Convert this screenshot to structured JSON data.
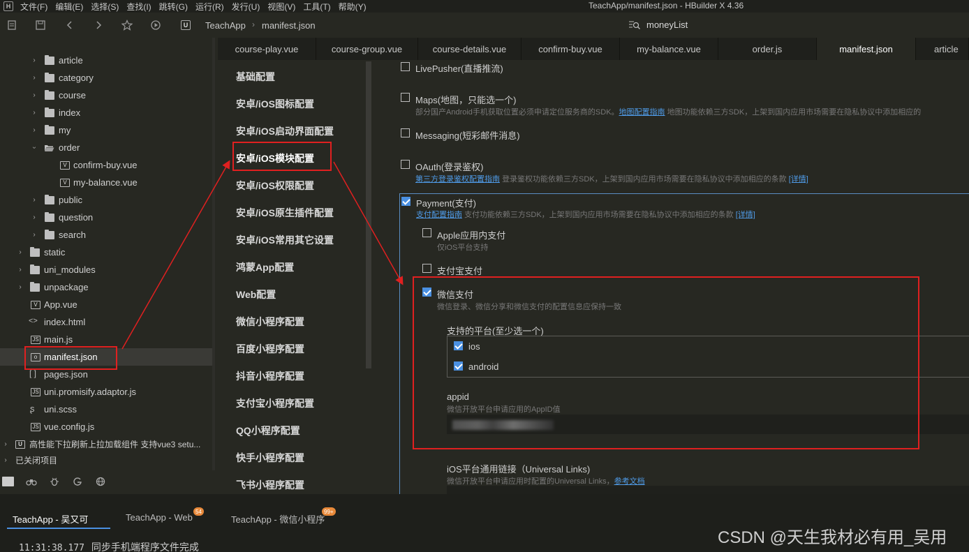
{
  "menubar": {
    "logo": "H",
    "items": [
      "文件(F)",
      "编辑(E)",
      "选择(S)",
      "查找(I)",
      "跳转(G)",
      "运行(R)",
      "发行(U)",
      "视图(V)",
      "工具(T)",
      "帮助(Y)"
    ],
    "title": "TeachApp/manifest.json - HBuilder X 4.36"
  },
  "toolbar": {
    "crumb_logo": "U",
    "breadcrumb": [
      "TeachApp",
      "manifest.json"
    ],
    "search_text": "moneyList"
  },
  "tree": {
    "items": [
      {
        "label": "article",
        "type": "folder",
        "expanded": false
      },
      {
        "label": "category",
        "type": "folder",
        "expanded": false
      },
      {
        "label": "course",
        "type": "folder",
        "expanded": false
      },
      {
        "label": "index",
        "type": "folder",
        "expanded": false
      },
      {
        "label": "my",
        "type": "folder",
        "expanded": false
      },
      {
        "label": "order",
        "type": "folder",
        "expanded": true
      },
      {
        "label": "confirm-buy.vue",
        "type": "vue"
      },
      {
        "label": "my-balance.vue",
        "type": "vue"
      },
      {
        "label": "public",
        "type": "folder",
        "expanded": false
      },
      {
        "label": "question",
        "type": "folder",
        "expanded": false
      },
      {
        "label": "search",
        "type": "folder",
        "expanded": false
      },
      {
        "label": "static",
        "type": "folder",
        "expanded": false
      },
      {
        "label": "uni_modules",
        "type": "folder",
        "expanded": false
      },
      {
        "label": "unpackage",
        "type": "folder",
        "expanded": false
      },
      {
        "label": "App.vue",
        "type": "vue"
      },
      {
        "label": "index.html",
        "type": "html"
      },
      {
        "label": "main.js",
        "type": "js"
      },
      {
        "label": "manifest.json",
        "type": "json",
        "selected": true
      },
      {
        "label": "pages.json",
        "type": "json"
      },
      {
        "label": "uni.promisify.adaptor.js",
        "type": "js"
      },
      {
        "label": "uni.scss",
        "type": "scss"
      },
      {
        "label": "vue.config.js",
        "type": "js"
      },
      {
        "label": "高性能下拉刷新上拉加载组件 支持vue3 setu...",
        "type": "project"
      },
      {
        "label": "已关闭项目",
        "type": "closed"
      }
    ]
  },
  "tabs": [
    "course-play.vue",
    "course-group.vue",
    "course-details.vue",
    "confirm-buy.vue",
    "my-balance.vue",
    "order.js",
    "manifest.json",
    "article"
  ],
  "active_tab": "manifest.json",
  "config_nav": [
    "基础配置",
    "安卓/iOS图标配置",
    "安卓/iOS启动界面配置",
    "安卓/iOS模块配置",
    "安卓/iOS权限配置",
    "安卓/iOS原生插件配置",
    "安卓/iOS常用其它设置",
    "鸿蒙App配置",
    "Web配置",
    "微信小程序配置",
    "百度小程序配置",
    "抖音小程序配置",
    "支付宝小程序配置",
    "QQ小程序配置",
    "快手小程序配置",
    "飞书小程序配置"
  ],
  "modules": {
    "livepusher": {
      "label": "LivePusher(直播推流)",
      "checked": false
    },
    "maps": {
      "label": "Maps(地图，只能选一个)",
      "checked": false,
      "desc_pre": "部分国产Android手机获取位置必须申请定位服务商的SDK。",
      "desc_link": "地图配置指南",
      "desc_post": "地图功能依赖三方SDK，上架到国内应用市场需要在隐私协议中添加相应的"
    },
    "messaging": {
      "label": "Messaging(短彩邮件消息)",
      "checked": false
    },
    "oauth": {
      "label": "OAuth(登录鉴权)",
      "checked": false,
      "desc_link": "第三方登录鉴权配置指南",
      "desc_post": "登录鉴权功能依赖三方SDK，上架到国内应用市场需要在隐私协议中添加相应的条款",
      "detail_link": "[详情]"
    },
    "payment": {
      "label": "Payment(支付)",
      "checked": true,
      "desc_link": "支付配置指南",
      "desc_post": "支付功能依赖三方SDK，上架到国内应用市场需要在隐私协议中添加相应的条款",
      "detail_link": "[详情]",
      "apple": {
        "label": "Apple应用内支付",
        "desc": "仅iOS平台支持",
        "checked": false
      },
      "alipay": {
        "label": "支付宝支付",
        "checked": false
      },
      "wechat": {
        "label": "微信支付",
        "desc": "微信登录、微信分享和微信支付的配置信息应保持一致",
        "checked": true,
        "platform_title": "支持的平台(至少选一个)",
        "platforms": [
          {
            "label": "ios",
            "checked": true
          },
          {
            "label": "android",
            "checked": true
          }
        ],
        "appid_label": "appid",
        "appid_desc": "微信开放平台申请应用的AppID值",
        "ul_label": "iOS平台通用链接（Universal Links)",
        "ul_desc": "微信开放平台申请应用时配置的Universal Links，",
        "ul_link": "参考文档"
      }
    }
  },
  "console": {
    "tabs": [
      {
        "label": "TeachApp - 吴又可",
        "active": true
      },
      {
        "label": "TeachApp - Web",
        "badge": "54"
      },
      {
        "label": "TeachApp - 微信小程序",
        "badge": "99+"
      }
    ],
    "log_time": "11:31:38.177",
    "log_text": "同步手机端程序文件完成"
  },
  "watermark": "CSDN @天生我材必有用_吴用",
  "colors": {
    "accent": "#4a90e2",
    "annotation": "#e02020",
    "link": "#4f9be8"
  }
}
